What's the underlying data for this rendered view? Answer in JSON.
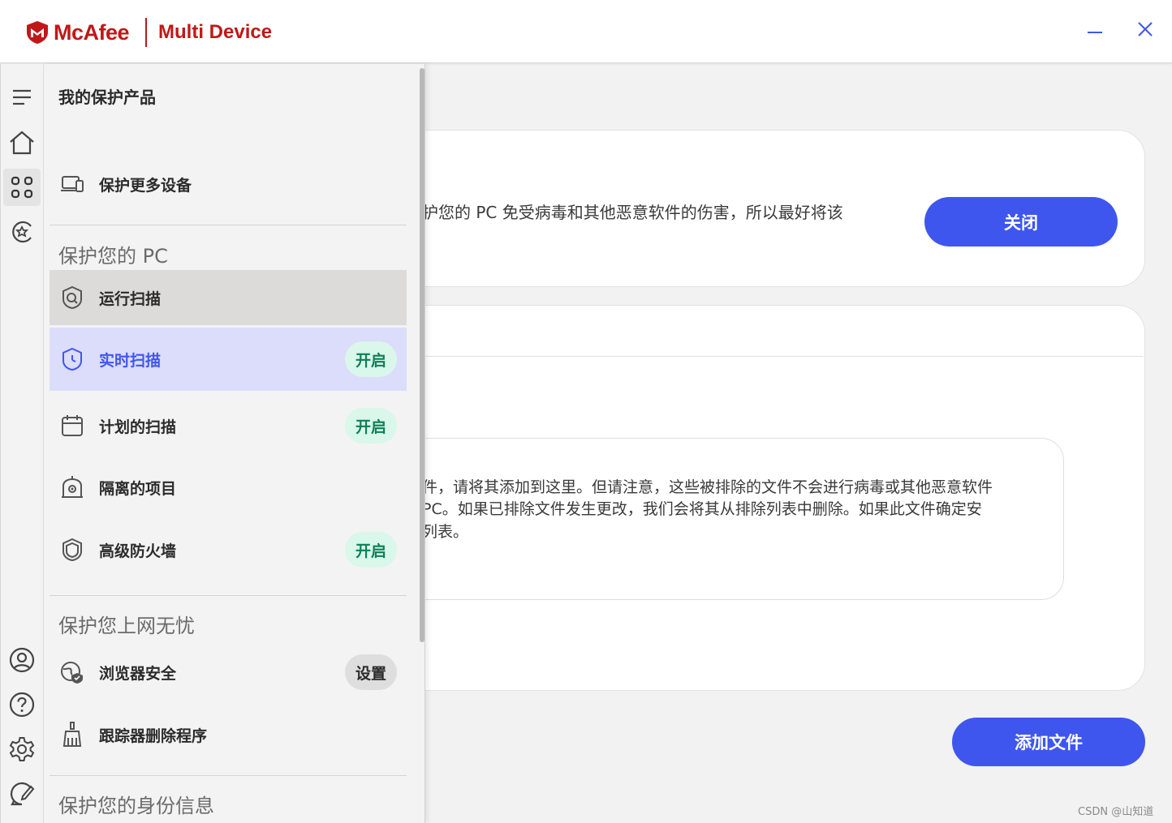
{
  "titlebar": {
    "brand_name": "McAfee",
    "product_name": "Multi Device",
    "minimize_label": "—",
    "close_label": "✕"
  },
  "main": {
    "card1_text": "护您的 PC 免受病毒和其他恶意软件的伤害，所以最好将该",
    "close_button": "关闭",
    "desc_lines": [
      "件，请将其添加到这里。但请注意，这些被排除的文件不会进行病毒或其他恶意软件",
      "PC。如果已排除文件发生更改，我们会将其从排除列表中删除。如果此文件确定安",
      "列表。"
    ],
    "add_file_button": "添加文件"
  },
  "drawer": {
    "title": "我的保护产品",
    "protect_more": "保护更多设备",
    "section_pc": "保护您的 PC",
    "items_pc": [
      {
        "label": "运行扫描",
        "badge": ""
      },
      {
        "label": "实时扫描",
        "badge": "开启"
      },
      {
        "label": "计划的扫描",
        "badge": "开启"
      },
      {
        "label": "隔离的项目",
        "badge": ""
      },
      {
        "label": "高级防火墙",
        "badge": "开启"
      }
    ],
    "section_web": "保护您上网无忧",
    "items_web": [
      {
        "label": "浏览器安全",
        "badge": "设置"
      },
      {
        "label": "跟踪器删除程序",
        "badge": ""
      }
    ],
    "section_identity": "保护您的身份信息"
  },
  "rail": {
    "icons": [
      "menu-icon",
      "home-icon",
      "apps-grid-icon",
      "protection-score-icon",
      "account-icon",
      "help-icon",
      "settings-icon",
      "feedback-icon"
    ]
  },
  "watermark": "CSDN @山知道",
  "colors": {
    "brand_red": "#c01818",
    "primary_blue": "#3f56ee",
    "status_on_bg": "#d9f7ea",
    "status_on_text": "#0d7f5a"
  }
}
